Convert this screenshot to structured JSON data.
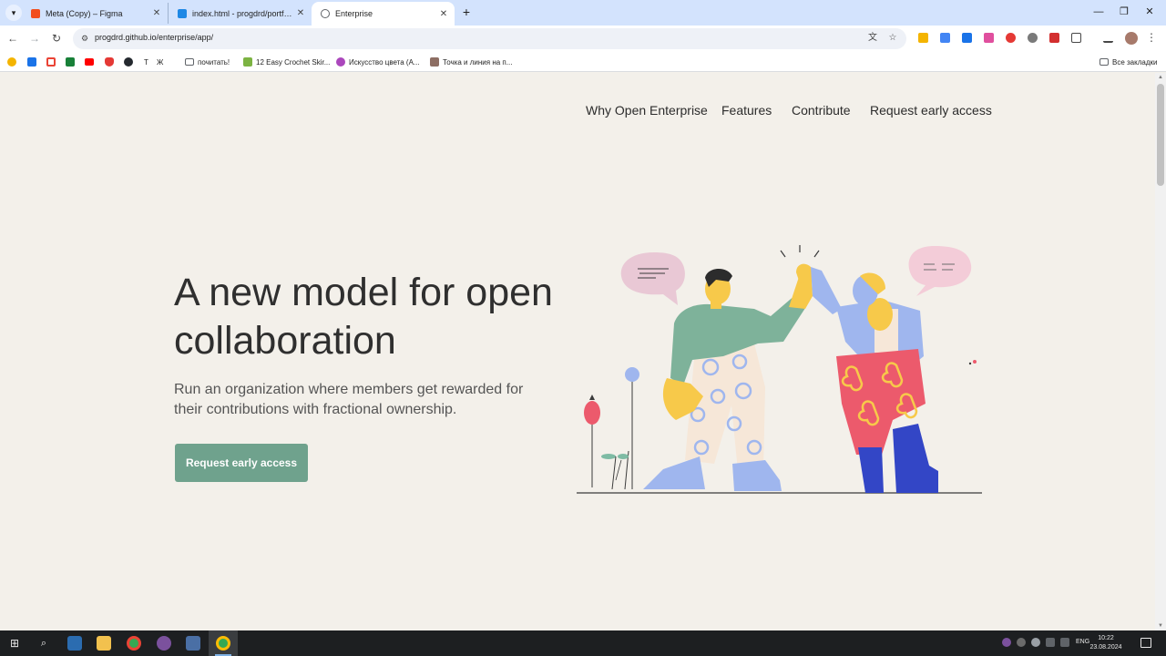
{
  "browser": {
    "tabs": [
      {
        "title": "Meta (Copy) – Figma",
        "favicon": "figma-icon",
        "color": "#f24e1e"
      },
      {
        "title": "index.html - progdrd/portfolio",
        "favicon": "vscode-icon",
        "color": "#1e88e5"
      },
      {
        "title": "Enterprise",
        "favicon": "globe-icon",
        "color": "#5f6368"
      }
    ],
    "url": "progdrd.github.io/enterprise/app/",
    "bookmarks": [
      {
        "label": "",
        "icon": "sun-icon",
        "color": "#f4b400"
      },
      {
        "label": "",
        "icon": "bolt-icon",
        "color": "#1a73e8"
      },
      {
        "label": "",
        "icon": "gmail-icon",
        "color": "#ea4335"
      },
      {
        "label": "",
        "icon": "classroom-icon",
        "color": "#188038"
      },
      {
        "label": "",
        "icon": "youtube-icon",
        "color": "#ff0000"
      },
      {
        "label": "",
        "icon": "shield-icon",
        "color": "#e53935"
      },
      {
        "label": "",
        "icon": "github-icon",
        "color": "#24292f"
      },
      {
        "label": "Т",
        "icon": "text-icon",
        "color": "#ffffff"
      },
      {
        "label": "Ж",
        "icon": "text-icon",
        "color": "#ffffff"
      },
      {
        "label": "почитать!",
        "icon": "folder-icon",
        "color": "#5f6368"
      },
      {
        "label": "12 Easy Crochet Skir...",
        "icon": "bow-icon",
        "color": "#7cb342"
      },
      {
        "label": "Искусство цвета (A...",
        "icon": "color-wheel-icon",
        "color": "#ab47bc"
      },
      {
        "label": "Точка и линия на п...",
        "icon": "book-icon",
        "color": "#8d6e63"
      }
    ],
    "all_bookmarks": "Все закладки"
  },
  "site": {
    "nav": [
      "Why Open Enterprise",
      "Features",
      "Contribute",
      "Request early access"
    ],
    "hero_title": "A new model for open collaboration",
    "hero_subtitle": "Run an organization where members get rewarded for their contributions with fractional ownership.",
    "cta_label": "Request early access",
    "accent_color": "#6fa28d"
  },
  "taskbar": {
    "language": "ENG",
    "time": "10:22",
    "date": "23.08.2024"
  }
}
